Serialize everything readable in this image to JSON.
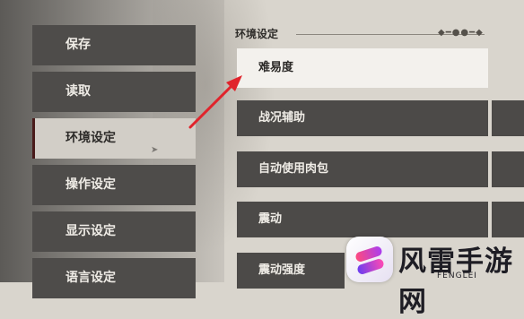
{
  "menu": {
    "items": [
      {
        "label": "保存"
      },
      {
        "label": "读取"
      },
      {
        "label": "环境设定"
      },
      {
        "label": "操作设定"
      },
      {
        "label": "显示设定"
      },
      {
        "label": "语言设定"
      }
    ],
    "active_index": 2
  },
  "section": {
    "title": "环境设定"
  },
  "options": [
    {
      "label": "难易度"
    },
    {
      "label": "战况辅助"
    },
    {
      "label": "自动使用肉包"
    },
    {
      "label": "震动"
    },
    {
      "label": "震动强度"
    }
  ],
  "watermark": {
    "title": "风雷手游网",
    "subtitle": "FENGLEI"
  },
  "colors": {
    "menu_bg": "#4e4c4a",
    "menu_active_bg": "#d2cec7",
    "active_marker": "#4a1b1b",
    "option_bg": "#4c4a48",
    "option_active_bg": "#f3f1ed",
    "arrow": "#e0242c"
  }
}
